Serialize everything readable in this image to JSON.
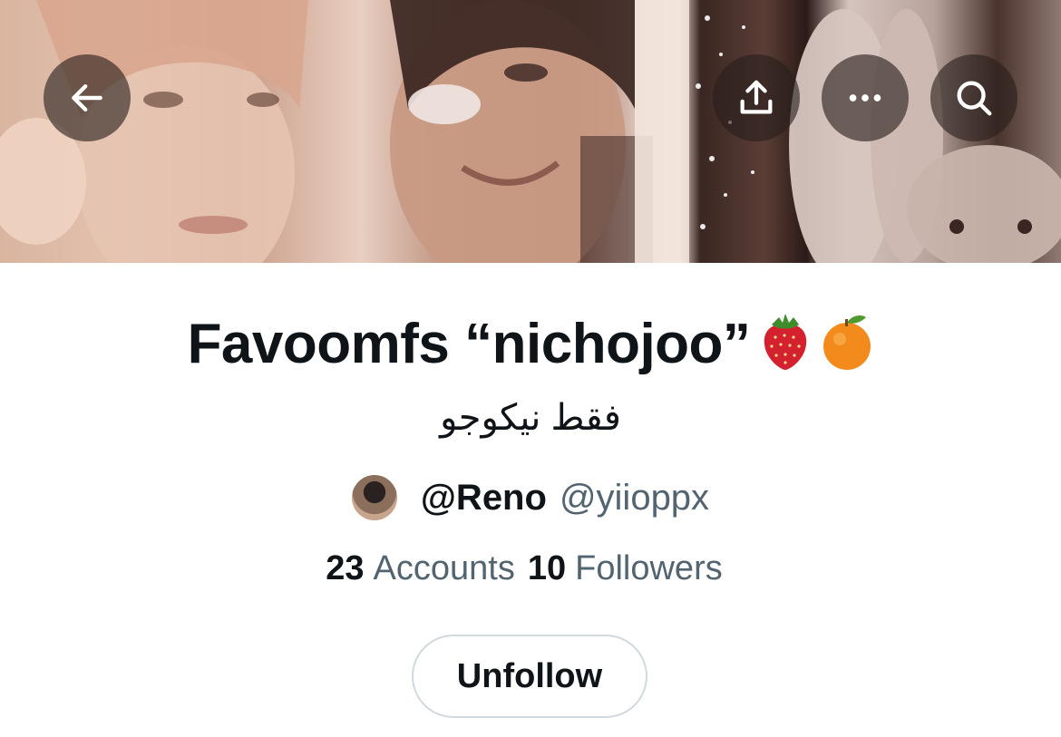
{
  "header": {
    "back_icon": "arrow-left-icon",
    "share_icon": "share-upload-icon",
    "more_icon": "more-horizontal-icon",
    "search_icon": "search-icon"
  },
  "list": {
    "title": "Favoomfs “nichojoo”",
    "title_emojis": [
      "strawberry-emoji",
      "orange-emoji"
    ],
    "description": "فقط نيكوجو",
    "owner_name": "@Reno",
    "owner_handle": "@yiioppx"
  },
  "stats": {
    "accounts_count": "23",
    "accounts_label": "Accounts",
    "followers_count": "10",
    "followers_label": "Followers"
  },
  "actions": {
    "unfollow_label": "Unfollow"
  },
  "colors": {
    "text_primary": "#0f1419",
    "text_secondary": "#536471",
    "button_border": "#cfd9de",
    "overlay_button": "rgba(40,30,28,0.62)"
  }
}
